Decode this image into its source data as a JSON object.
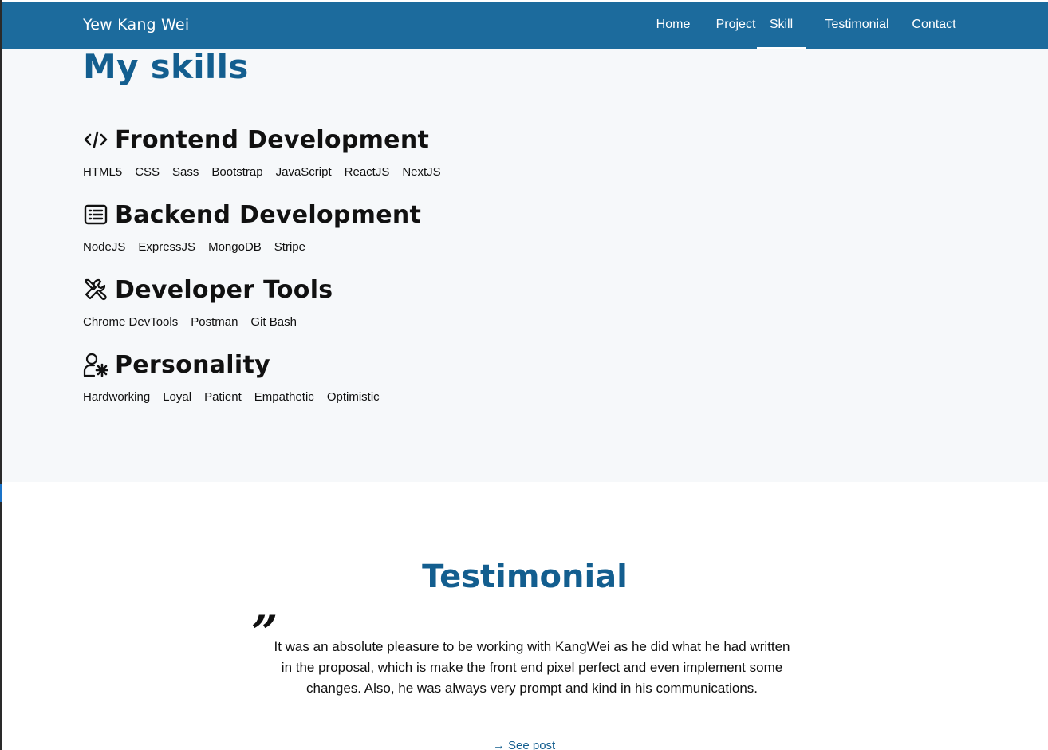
{
  "header": {
    "brand": "Yew Kang Wei",
    "nav": [
      {
        "label": "Home",
        "active": false
      },
      {
        "label": "Project",
        "active": false
      },
      {
        "label": "Skill",
        "active": true
      },
      {
        "label": "Testimonial",
        "active": false
      },
      {
        "label": "Contact",
        "active": false
      }
    ]
  },
  "skills": {
    "title": "My skills",
    "groups": [
      {
        "icon": "code-icon",
        "title": "Frontend Development",
        "tags": [
          "HTML5",
          "CSS",
          "Sass",
          "Bootstrap",
          "JavaScript",
          "ReactJS",
          "NextJS"
        ]
      },
      {
        "icon": "server-list-icon",
        "title": "Backend Development",
        "tags": [
          "NodeJS",
          "ExpressJS",
          "MongoDB",
          "Stripe"
        ]
      },
      {
        "icon": "tools-icon",
        "title": "Developer Tools",
        "tags": [
          "Chrome DevTools",
          "Postman",
          "Git Bash"
        ]
      },
      {
        "icon": "user-gear-icon",
        "title": "Personality",
        "tags": [
          "Hardworking",
          "Loyal",
          "Patient",
          "Empathetic",
          "Optimistic"
        ]
      }
    ]
  },
  "testimonial": {
    "title": "Testimonial",
    "quote_mark": "”",
    "quote": "It was an absolute pleasure to be working with KangWei as he did what he had written in the proposal, which is make the front end pixel perfect and even implement some changes. Also, he was always very prompt and kind in his communications.",
    "link_arrow": "→",
    "link_label": "See post"
  },
  "colors": {
    "navbar": "#1c6b9d",
    "accent": "#135e8f",
    "skills_bg": "#f6f8fa"
  }
}
